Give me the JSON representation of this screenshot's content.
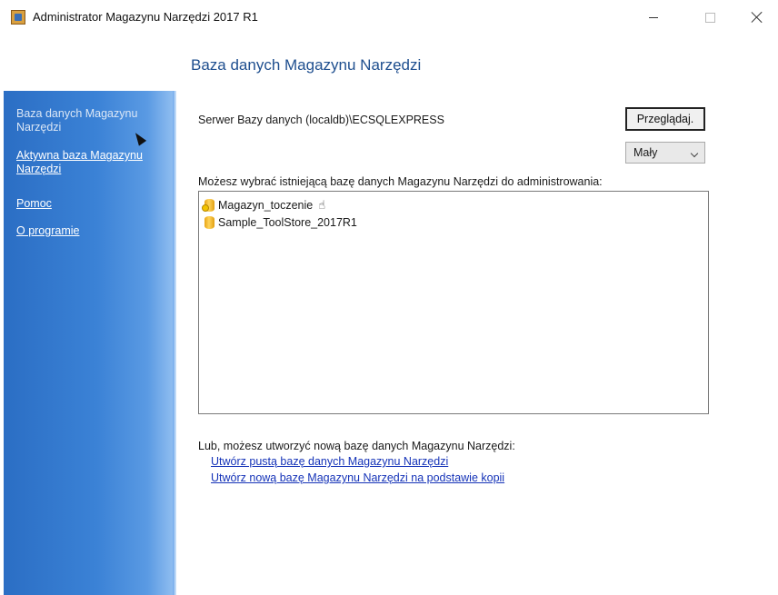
{
  "window": {
    "title": "Administrator Magazynu Narzędzi 2017 R1"
  },
  "header": {
    "page_title": "Baza danych Magazynu Narzędzi"
  },
  "sidebar": {
    "items": [
      {
        "label": "Baza danych Magazynu Narzędzi",
        "active": true
      },
      {
        "label": "Aktywna baza Magazynu Narzędzi",
        "active": false
      },
      {
        "label": "Pomoc",
        "active": false
      },
      {
        "label": "O programie",
        "active": false
      }
    ]
  },
  "server": {
    "label": "Serwer Bazy danych (localdb)\\ECSQLEXPRESS",
    "browse_label": "Przeglądaj.",
    "size_value": "Mały"
  },
  "database_list": {
    "label": "Możesz wybrać istniejącą bazę danych Magazynu Narzędzi do administrowania:",
    "items": [
      {
        "name": "Magazyn_toczenie",
        "active": true
      },
      {
        "name": "Sample_ToolStore_2017R1",
        "active": false
      }
    ]
  },
  "create": {
    "label": "Lub, możesz utworzyć nową bazę danych Magazynu Narzędzi:",
    "links": [
      "Utwórz pustą bazę danych Magazynu Narzędzi",
      "Utwórz nową bazę Magazynu Narzędzi na podstawie kopii"
    ]
  },
  "icons": {
    "app": "app-icon",
    "database": "database-icon",
    "hand": "hand-pointer-icon"
  }
}
